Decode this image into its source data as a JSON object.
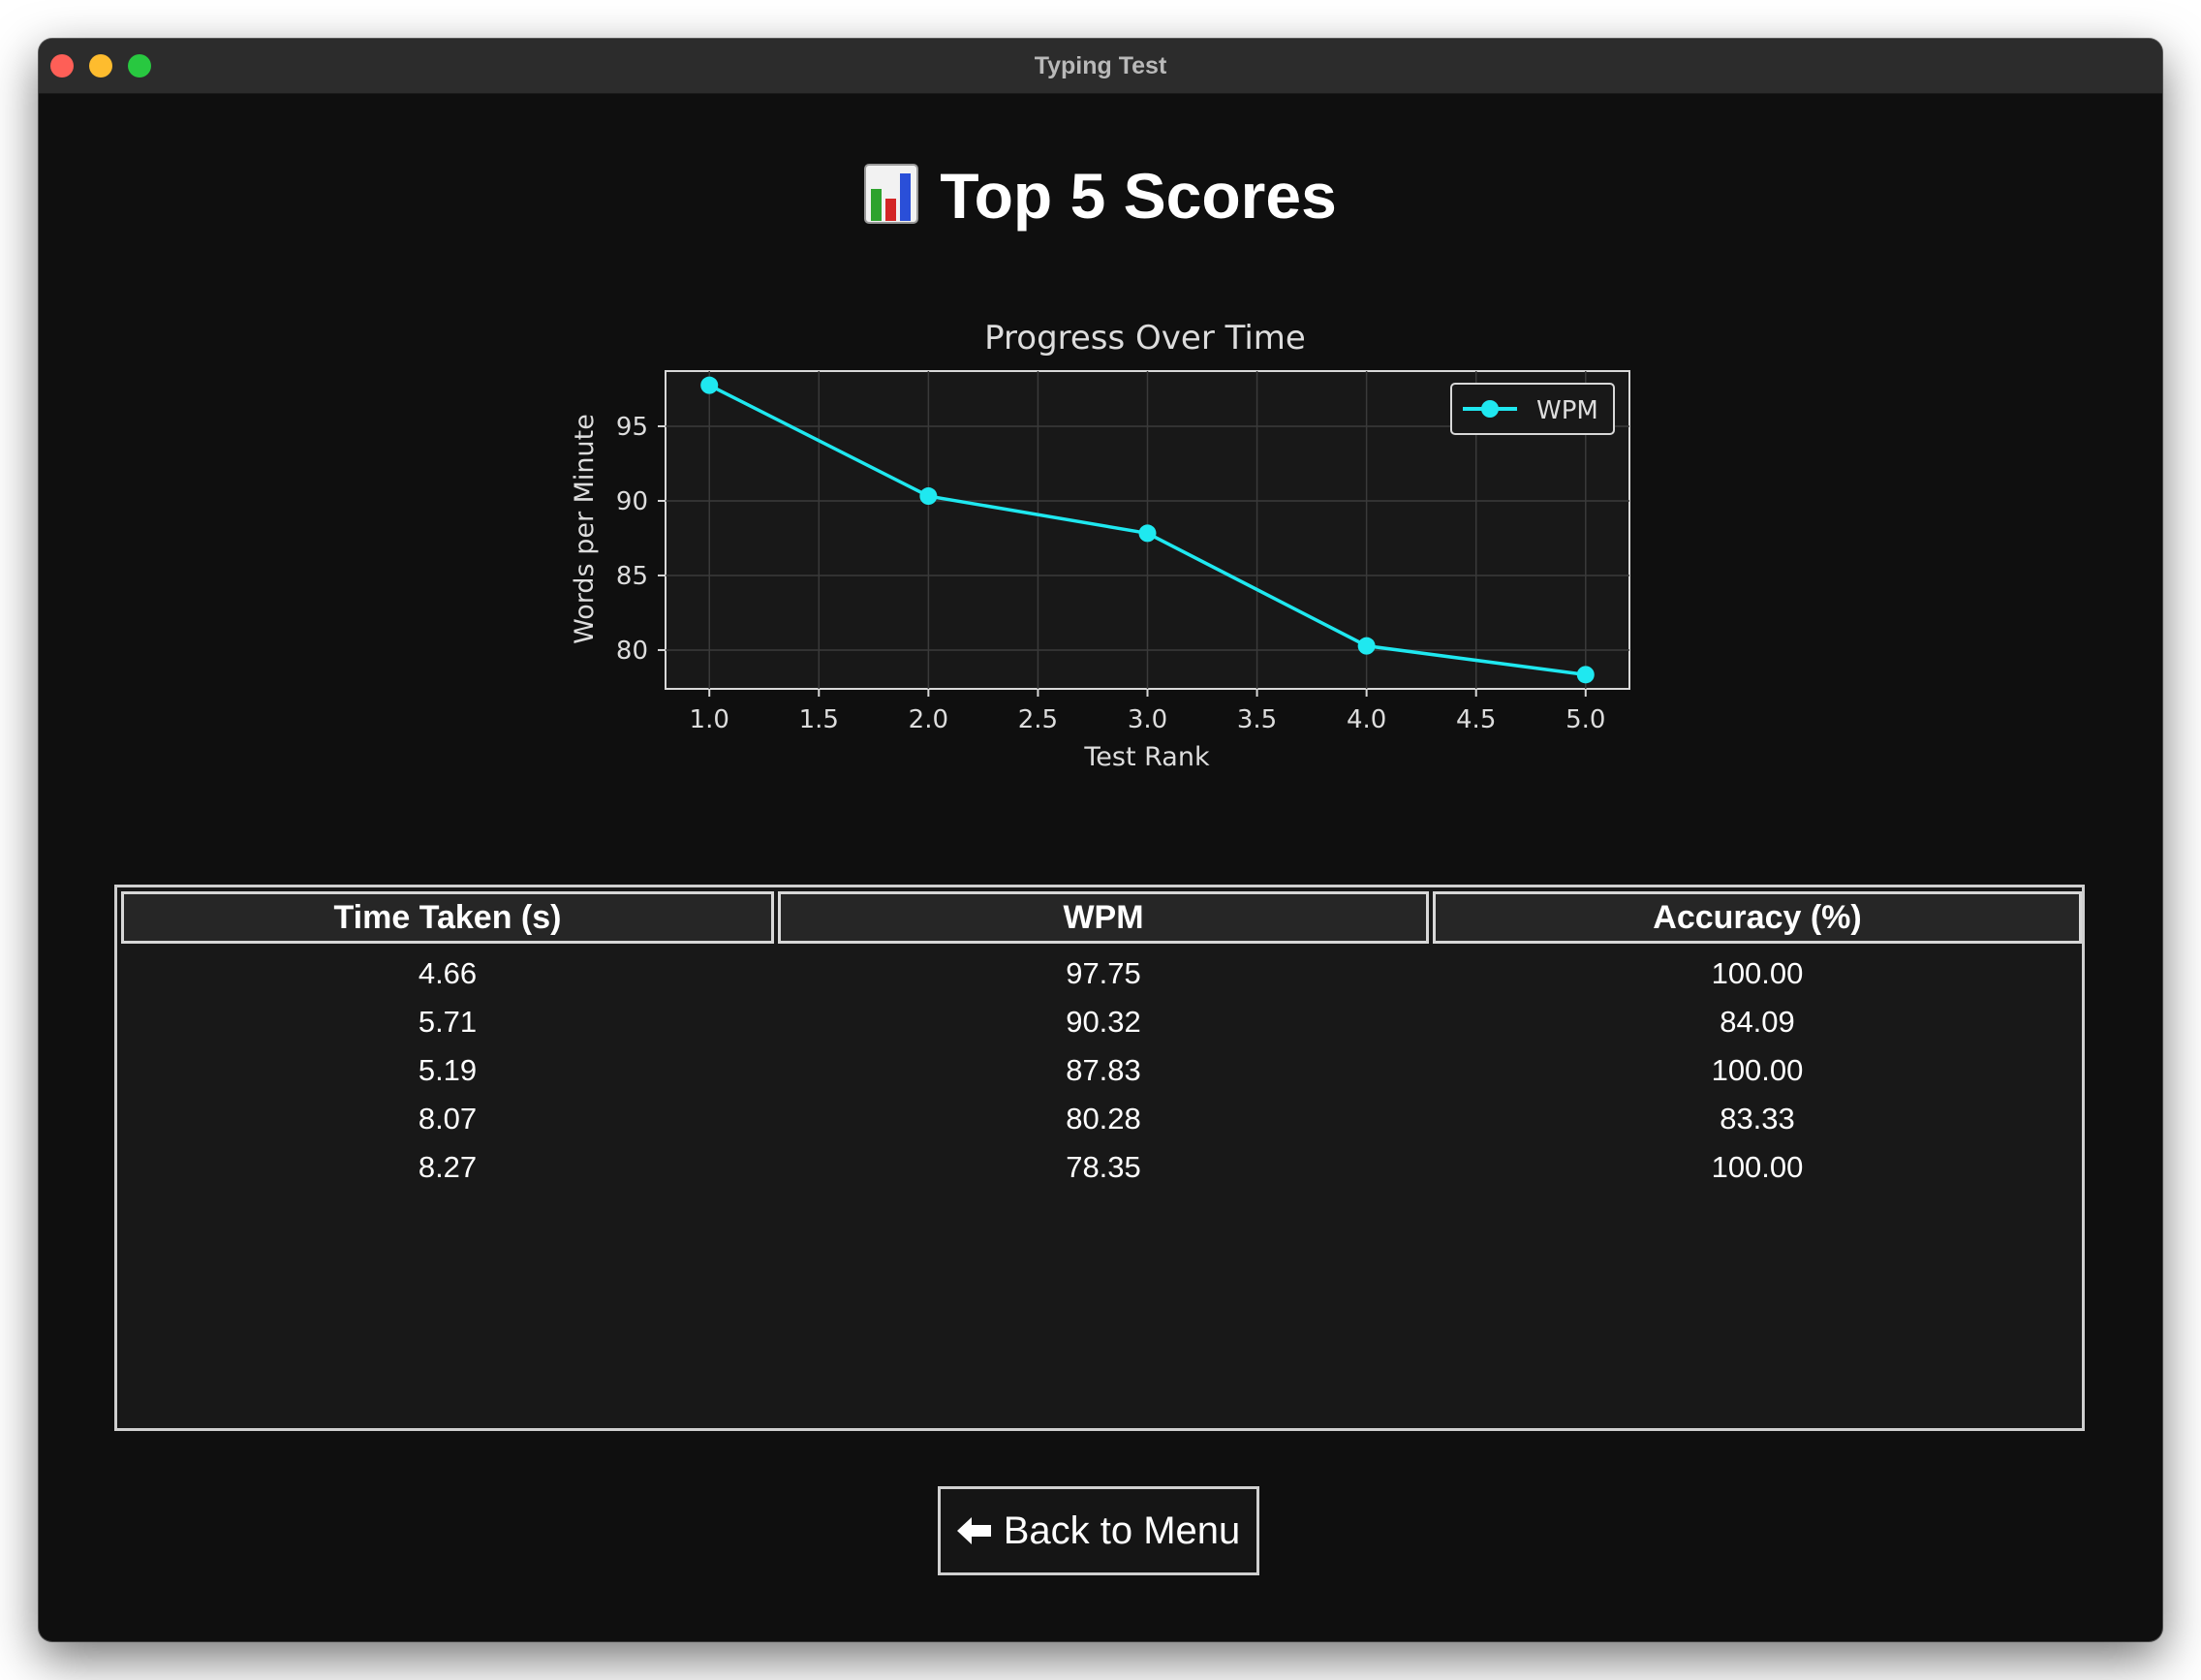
{
  "window": {
    "title": "Typing Test"
  },
  "header": {
    "icon": "bar-chart-emoji-icon",
    "title": "Top 5 Scores"
  },
  "chart_data": {
    "type": "line",
    "title": "Progress Over Time",
    "xlabel": "Test Rank",
    "ylabel": "Words per Minute",
    "x": [
      1,
      2,
      3,
      4,
      5
    ],
    "series": [
      {
        "name": "WPM",
        "values": [
          97.75,
          90.32,
          87.83,
          80.28,
          78.35
        ],
        "color": "#1fe8f0"
      }
    ],
    "xlim": [
      0.8,
      5.2
    ],
    "ylim": [
      77.4,
      98.7
    ],
    "xticks": [
      "1.0",
      "1.5",
      "2.0",
      "2.5",
      "3.0",
      "3.5",
      "4.0",
      "4.5",
      "5.0"
    ],
    "yticks": [
      "80",
      "85",
      "90",
      "95"
    ],
    "grid": true,
    "legend": "top-right",
    "markers": true
  },
  "table": {
    "columns": [
      "Time Taken (s)",
      "WPM",
      "Accuracy (%)"
    ],
    "rows": [
      [
        "4.66",
        "97.75",
        "100.00"
      ],
      [
        "5.71",
        "90.32",
        "84.09"
      ],
      [
        "5.19",
        "87.83",
        "100.00"
      ],
      [
        "8.07",
        "80.28",
        "83.33"
      ],
      [
        "8.27",
        "78.35",
        "100.00"
      ]
    ]
  },
  "actions": {
    "back_label": "Back to Menu",
    "back_icon": "arrow-left-icon"
  },
  "colors": {
    "background": "#0f0f0f",
    "line": "#1fe8f0",
    "titlebar": "#2c2c2c"
  }
}
